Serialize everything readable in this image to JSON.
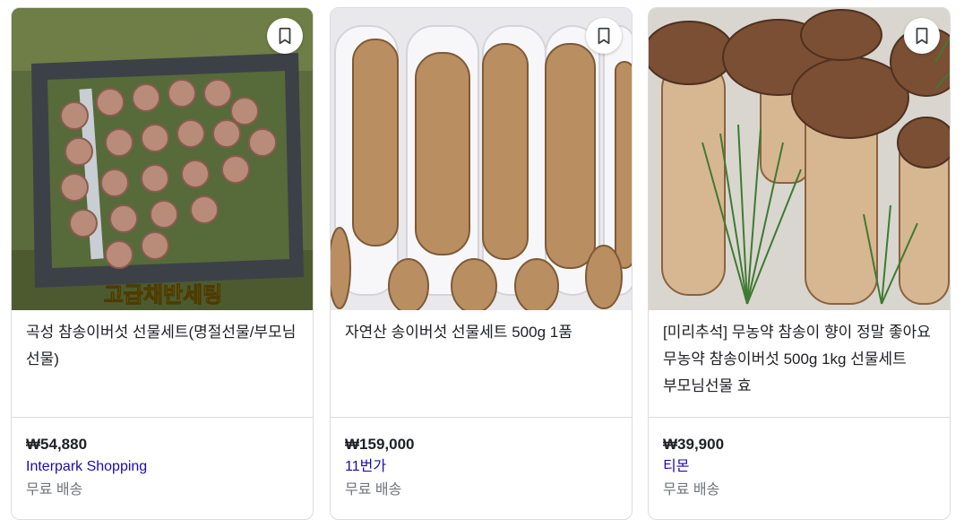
{
  "products": [
    {
      "title": "곡성 참송이버섯 선물세트(명절선물/부모님 선물)",
      "price": "₩54,880",
      "seller": "Interpark Shopping",
      "shipping": "무료 배송",
      "image_caption": "고급채반세팅",
      "image_icon": "mushroom-gift-box-image"
    },
    {
      "title": "자연산 송이버섯 선물세트 500g 1품",
      "price": "₩159,000",
      "seller": "11번가",
      "shipping": "무료 배송",
      "image_icon": "pine-mushroom-tray-image"
    },
    {
      "title": "[미리추석] 무농약 참송이 향이 정말 좋아요 무농약 참송이버섯 500g 1kg 선물세트 부모님선물 효",
      "price": "₩39,900",
      "seller": "티몬",
      "shipping": "무료 배송",
      "image_icon": "mushroom-pine-needles-image"
    }
  ],
  "colors": {
    "seller_link": "#1a0dab",
    "price": "#202124",
    "muted": "#70757a",
    "border": "#dadce0"
  }
}
